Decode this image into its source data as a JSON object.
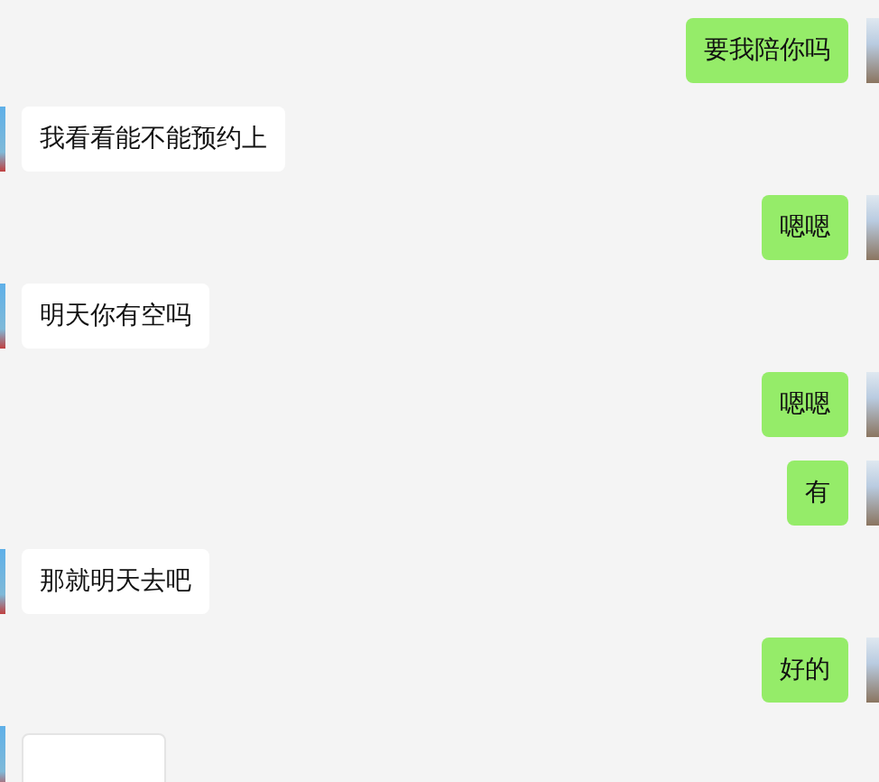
{
  "messages": [
    {
      "kind": "text",
      "outgoing": true,
      "text": "要我陪你吗"
    },
    {
      "kind": "text",
      "outgoing": false,
      "text": "我看看能不能预约上"
    },
    {
      "kind": "text",
      "outgoing": true,
      "text": "嗯嗯"
    },
    {
      "kind": "text",
      "outgoing": false,
      "text": "明天你有空吗"
    },
    {
      "kind": "text",
      "outgoing": true,
      "text": "嗯嗯"
    },
    {
      "kind": "text",
      "outgoing": true,
      "text": "有"
    },
    {
      "kind": "text",
      "outgoing": false,
      "text": "那就明天去吧"
    },
    {
      "kind": "text",
      "outgoing": true,
      "text": "好的"
    },
    {
      "kind": "image",
      "outgoing": false
    }
  ]
}
